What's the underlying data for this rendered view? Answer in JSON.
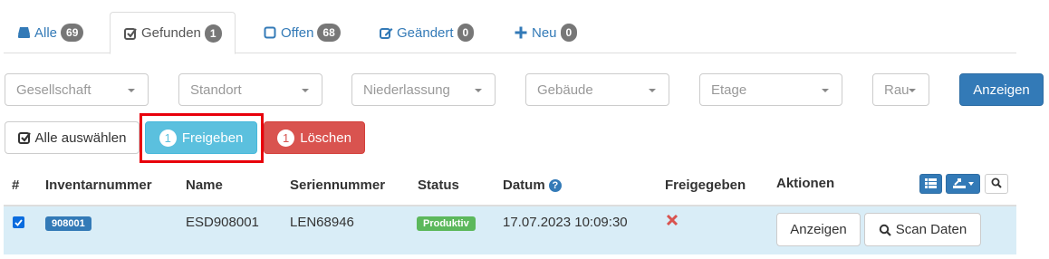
{
  "tabs": [
    {
      "label": "Alle",
      "count": "69",
      "icon": "hdd-icon"
    },
    {
      "label": "Gefunden",
      "count": "1",
      "icon": "check-square-icon"
    },
    {
      "label": "Offen",
      "count": "68",
      "icon": "square-icon"
    },
    {
      "label": "Geändert",
      "count": "0",
      "icon": "edit-icon"
    },
    {
      "label": "Neu",
      "count": "0",
      "icon": "plus-icon"
    }
  ],
  "filters": {
    "company": "Gesellschaft",
    "location": "Standort",
    "branch": "Niederlassung",
    "building": "Gebäude",
    "floor": "Etage",
    "room": "Rau",
    "show_button": "Anzeigen"
  },
  "actions": {
    "select_all": "Alle auswählen",
    "release_count": "1",
    "release": "Freigeben",
    "delete_count": "1",
    "delete": "Löschen"
  },
  "table": {
    "headers": {
      "index": "#",
      "inventory": "Inventarnummer",
      "name": "Name",
      "serial": "Seriennummer",
      "status": "Status",
      "date": "Datum",
      "released": "Freigegeben",
      "actions": "Aktionen"
    },
    "rows": [
      {
        "inventory": "908001",
        "name": "ESD908001",
        "serial": "LEN68946",
        "status": "Produktiv",
        "date": "17.07.2023 10:09:30",
        "show": "Anzeigen",
        "scan": "Scan Daten"
      }
    ]
  },
  "colors": {
    "primary": "#337ab7",
    "info": "#5bc0de",
    "danger": "#d9534f",
    "success": "#5cb85c",
    "row_selected": "#d9edf7",
    "highlight": "#e8000b"
  }
}
